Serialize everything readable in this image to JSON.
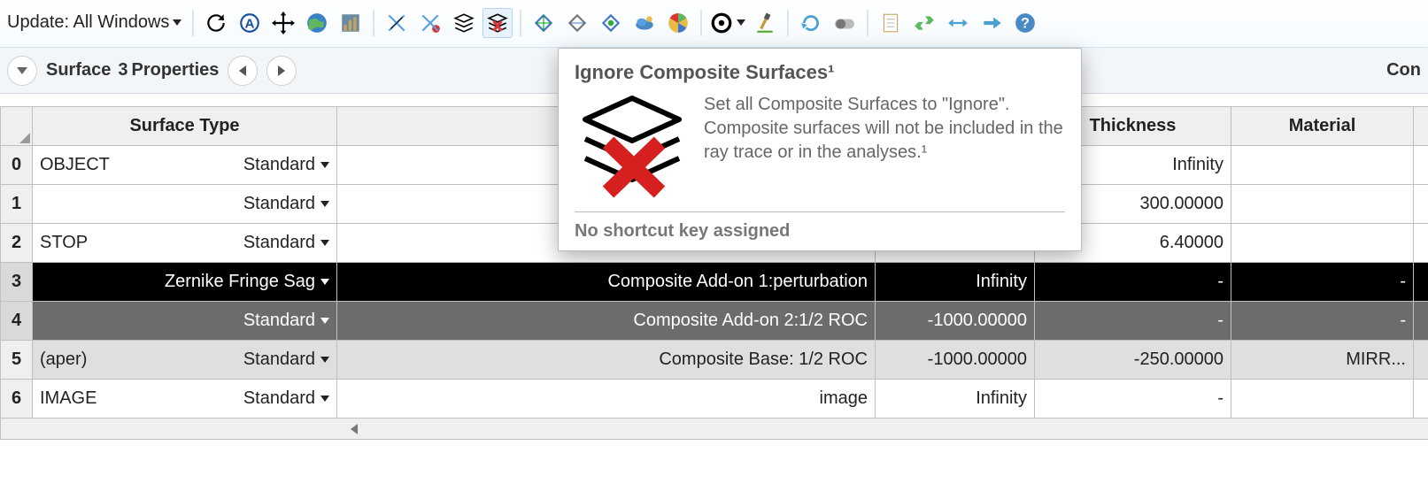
{
  "toolbar": {
    "update_label": "Update: All Windows"
  },
  "subbar": {
    "surface_label": "Surface",
    "surface_index": "3",
    "properties_label": "Properties",
    "right_label": "Con"
  },
  "tooltip": {
    "title": "Ignore Composite Surfaces¹",
    "desc": "Set all Composite Surfaces to \"Ignore\". Composite surfaces will not be included in the ray trace or in the analyses.¹",
    "footer": "No shortcut key assigned"
  },
  "columns": {
    "surface_type": "Surface Type",
    "comment": "",
    "radius": "",
    "thickness": "Thickness",
    "material": "Material"
  },
  "rows": [
    {
      "idx": "0",
      "name": "OBJECT",
      "type": "Standard",
      "comment": "",
      "radius": "",
      "thickness": "Infinity",
      "material": "",
      "style": "norm"
    },
    {
      "idx": "1",
      "name": "",
      "type": "Standard",
      "comment": "",
      "radius": "",
      "thickness": "300.00000",
      "material": "",
      "style": "norm"
    },
    {
      "idx": "2",
      "name": "STOP",
      "type": "Standard",
      "comment": "",
      "radius": "",
      "thickness": "6.40000",
      "material": "",
      "style": "norm"
    },
    {
      "idx": "3",
      "name": "",
      "type": "Zernike Fringe Sag",
      "comment": "Composite Add-on 1:perturbation",
      "radius": "Infinity",
      "thickness": "-",
      "material": "-",
      "style": "sel"
    },
    {
      "idx": "4",
      "name": "",
      "type": "Standard",
      "comment": "Composite Add-on 2:1/2 ROC",
      "radius": "-1000.00000",
      "thickness": "-",
      "material": "-",
      "style": "dark"
    },
    {
      "idx": "5",
      "name": "(aper)",
      "type": "Standard",
      "comment": "Composite Base: 1/2 ROC",
      "radius": "-1000.00000",
      "thickness": "-250.00000",
      "material": "MIRR...",
      "style": "lt"
    },
    {
      "idx": "6",
      "name": "IMAGE",
      "type": "Standard",
      "comment": "image",
      "radius": "Infinity",
      "thickness": "-",
      "material": "",
      "style": "norm"
    }
  ]
}
